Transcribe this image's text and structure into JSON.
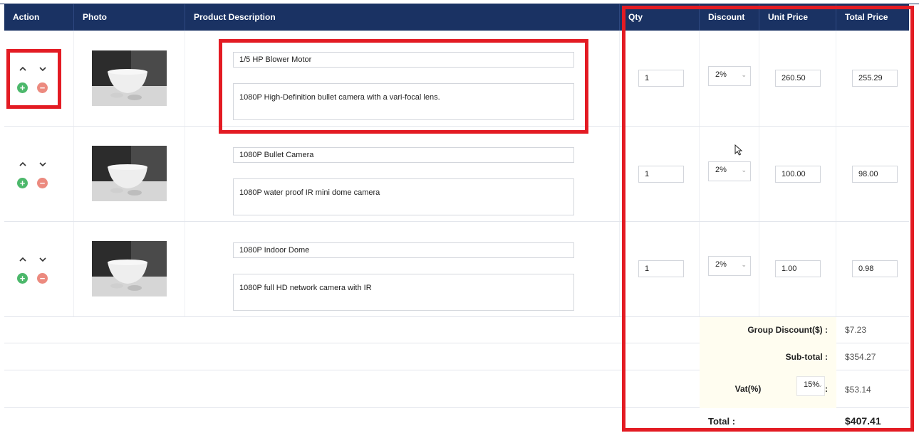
{
  "table": {
    "headers": {
      "action": "Action",
      "photo": "Photo",
      "description": "Product Description",
      "qty": "Qty",
      "discount": "Discount",
      "unit_price": "Unit Price",
      "total_price": "Total Price"
    },
    "rows": [
      {
        "name": "1/5 HP Blower Motor",
        "description": "1080P High-Definition bullet camera with a vari-focal lens.",
        "qty": "1",
        "discount": "2%",
        "unit_price": "260.50",
        "total_price": "255.29"
      },
      {
        "name": "1080P Bullet Camera",
        "description": "1080P water proof IR mini dome camera",
        "qty": "1",
        "discount": "2%",
        "unit_price": "100.00",
        "total_price": "98.00"
      },
      {
        "name": "1080P Indoor Dome",
        "description": "1080P full HD network camera with IR",
        "qty": "1",
        "discount": "2%",
        "unit_price": "1.00",
        "total_price": "0.98"
      }
    ]
  },
  "summary": {
    "group_discount_label": "Group Discount($) :",
    "group_discount_value": "$7.23",
    "subtotal_label": "Sub-total :",
    "subtotal_value": "$354.27",
    "vat_label": "Vat(%)",
    "vat_select": "15%",
    "vat_colon": ":",
    "vat_value": "$53.14",
    "total_label": "Total :",
    "total_value": "$407.41"
  },
  "icons": {
    "move_up": "chevron-up-icon",
    "move_down": "chevron-down-icon",
    "add": "plus-circle-icon",
    "remove": "minus-circle-icon",
    "add_glyph": "+",
    "remove_glyph": "−",
    "select_chevron": "⌄"
  },
  "colors": {
    "header_bg": "#1a3263",
    "highlight_border": "#e31b23",
    "add_button": "#4cb86b",
    "remove_button": "#ec8a7f"
  }
}
